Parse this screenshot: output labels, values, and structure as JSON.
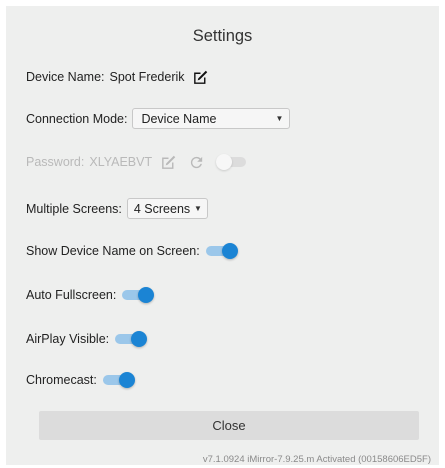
{
  "dialog": {
    "title": "Settings"
  },
  "device_name": {
    "label": "Device Name:",
    "value": "Spot Frederik",
    "edit_icon": "edit-icon"
  },
  "connection_mode": {
    "label": "Connection Mode:",
    "selected": "Device Name"
  },
  "password": {
    "label": "Password:",
    "value": "XLYAEBVT",
    "edit_icon": "edit-icon",
    "refresh_icon": "refresh-icon",
    "enabled": false
  },
  "multiple_screens": {
    "label": "Multiple Screens:",
    "selected": "4 Screens"
  },
  "toggles": {
    "show_device_name": {
      "label": "Show Device Name on Screen:",
      "on": true
    },
    "auto_fullscreen": {
      "label": "Auto Fullscreen:",
      "on": true
    },
    "airplay_visible": {
      "label": "AirPlay Visible:",
      "on": true
    },
    "chromecast": {
      "label": "Chromecast:",
      "on": true
    }
  },
  "close_label": "Close",
  "footer_text": "v7.1.0924 iMirror-7.9.25.m Activated (00158606ED5F)",
  "colors": {
    "accent": "#1b84d4",
    "accent_track": "#9bc7ea",
    "dialog_bg": "#eeefee",
    "disabled_text": "#b9b9b9"
  }
}
